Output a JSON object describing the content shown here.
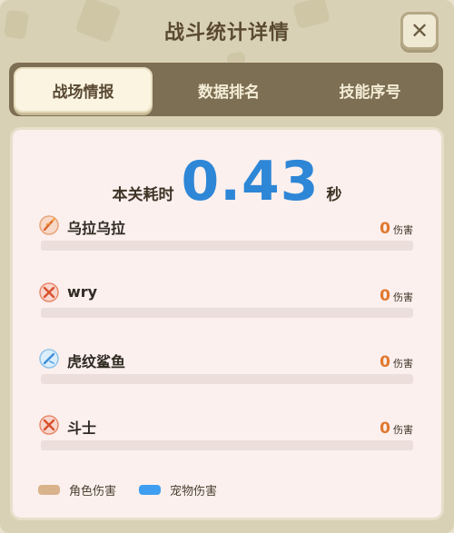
{
  "dialog": {
    "title": "战斗统计详情"
  },
  "tabs": [
    {
      "label": "战场情报",
      "active": true
    },
    {
      "label": "数据排名",
      "active": false
    },
    {
      "label": "技能序号",
      "active": false
    }
  ],
  "summary": {
    "time_label": "本关耗时",
    "time_value": "0.43",
    "time_unit": "秒"
  },
  "combatants": [
    {
      "name": "乌拉乌拉",
      "damage": "0",
      "damage_unit": "伤害",
      "icon": "fire-sword-icon",
      "damage_fraction": 0
    },
    {
      "name": "wry",
      "damage": "0",
      "damage_unit": "伤害",
      "icon": "crossed-swords-icon",
      "damage_fraction": 0
    },
    {
      "name": "虎纹鲨鱼",
      "damage": "0",
      "damage_unit": "伤害",
      "icon": "ice-blade-icon",
      "damage_fraction": 0
    },
    {
      "name": "斗士",
      "damage": "0",
      "damage_unit": "伤害",
      "icon": "crossed-swords-icon",
      "damage_fraction": 0
    }
  ],
  "legend": [
    {
      "label": "角色伤害",
      "color": "#d9b38c"
    },
    {
      "label": "宠物伤害",
      "color": "#3f9ef0"
    }
  ],
  "colors": {
    "accent_blue": "#2e86d6",
    "damage_orange": "#e0782e"
  }
}
